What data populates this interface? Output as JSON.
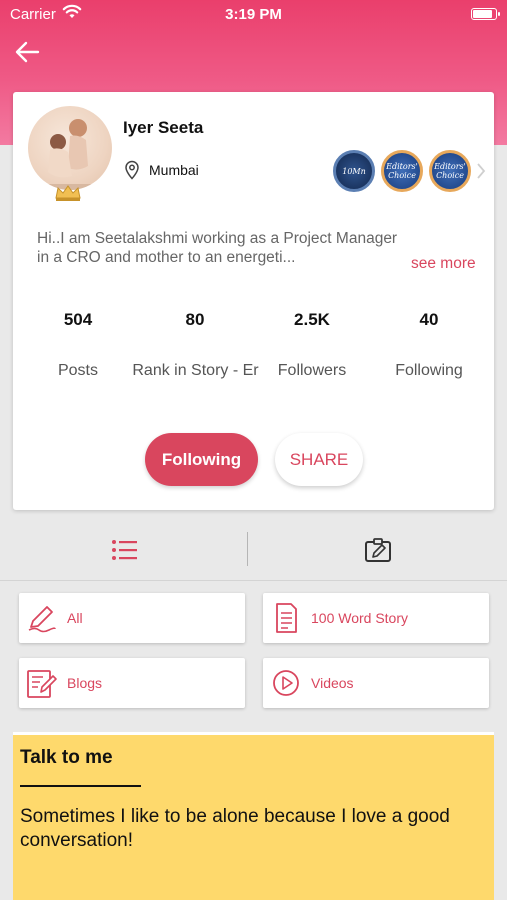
{
  "status_bar": {
    "carrier": "Carrier",
    "time": "3:19 PM"
  },
  "profile": {
    "name": "Iyer Seeta",
    "location": "Mumbai",
    "badges": [
      {
        "label": "10Mn",
        "icon": "ten-million-badge-icon"
      },
      {
        "label": "Editors' Choice",
        "icon": "editors-choice-badge-icon"
      },
      {
        "label": "Editors' Choice",
        "icon": "editors-choice-badge-icon"
      }
    ],
    "bio": "Hi..I am Seetalakshmi working as a Project Manager in a CRO and mother to an energeti...",
    "see_more": "see more"
  },
  "stats": [
    {
      "value": "504",
      "label": "Posts"
    },
    {
      "value": "80",
      "label": "Rank in Story - Er"
    },
    {
      "value": "2.5K",
      "label": "Followers"
    },
    {
      "value": "40",
      "label": "Following"
    }
  ],
  "actions": {
    "following": "Following",
    "share": "SHARE"
  },
  "filters": [
    {
      "label": "All",
      "icon": "pencil-scribble-icon"
    },
    {
      "label": "100 Word Story",
      "icon": "document-lines-icon"
    },
    {
      "label": "Blogs",
      "icon": "blog-edit-icon"
    },
    {
      "label": "Videos",
      "icon": "play-circle-icon"
    }
  ],
  "talk": {
    "title": "Talk to me",
    "text": "Sometimes I like to be alone because I love a good conversation!"
  },
  "colors": {
    "accent": "#d9465e",
    "header": "#ea3f6c",
    "note": "#fed96c"
  }
}
